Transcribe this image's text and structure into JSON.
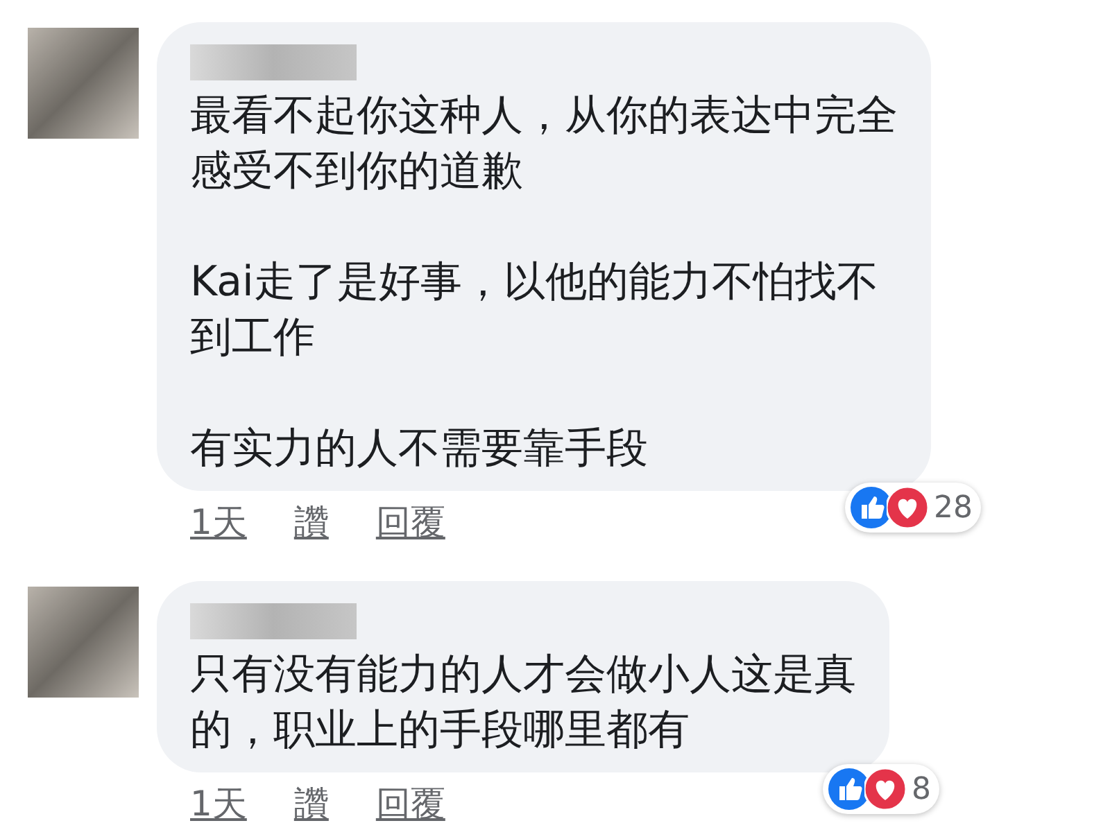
{
  "comments": [
    {
      "paragraphs": [
        [
          "最看不起你这种人，从你的表达中完全",
          "感受不到你的道歉"
        ],
        [
          "Kai走了是好事，以他的能力不怕找不",
          "到工作"
        ],
        [
          "有实力的人不需要靠手段"
        ]
      ],
      "reaction_count": "28",
      "time": "1天",
      "like": "讚",
      "reply": "回覆"
    },
    {
      "paragraphs": [
        [
          "只有没有能力的人才会做小人这是真",
          "的，职业上的手段哪里都有"
        ]
      ],
      "reaction_count": "8",
      "time": "1天",
      "like": "讚",
      "reply": "回覆"
    }
  ]
}
